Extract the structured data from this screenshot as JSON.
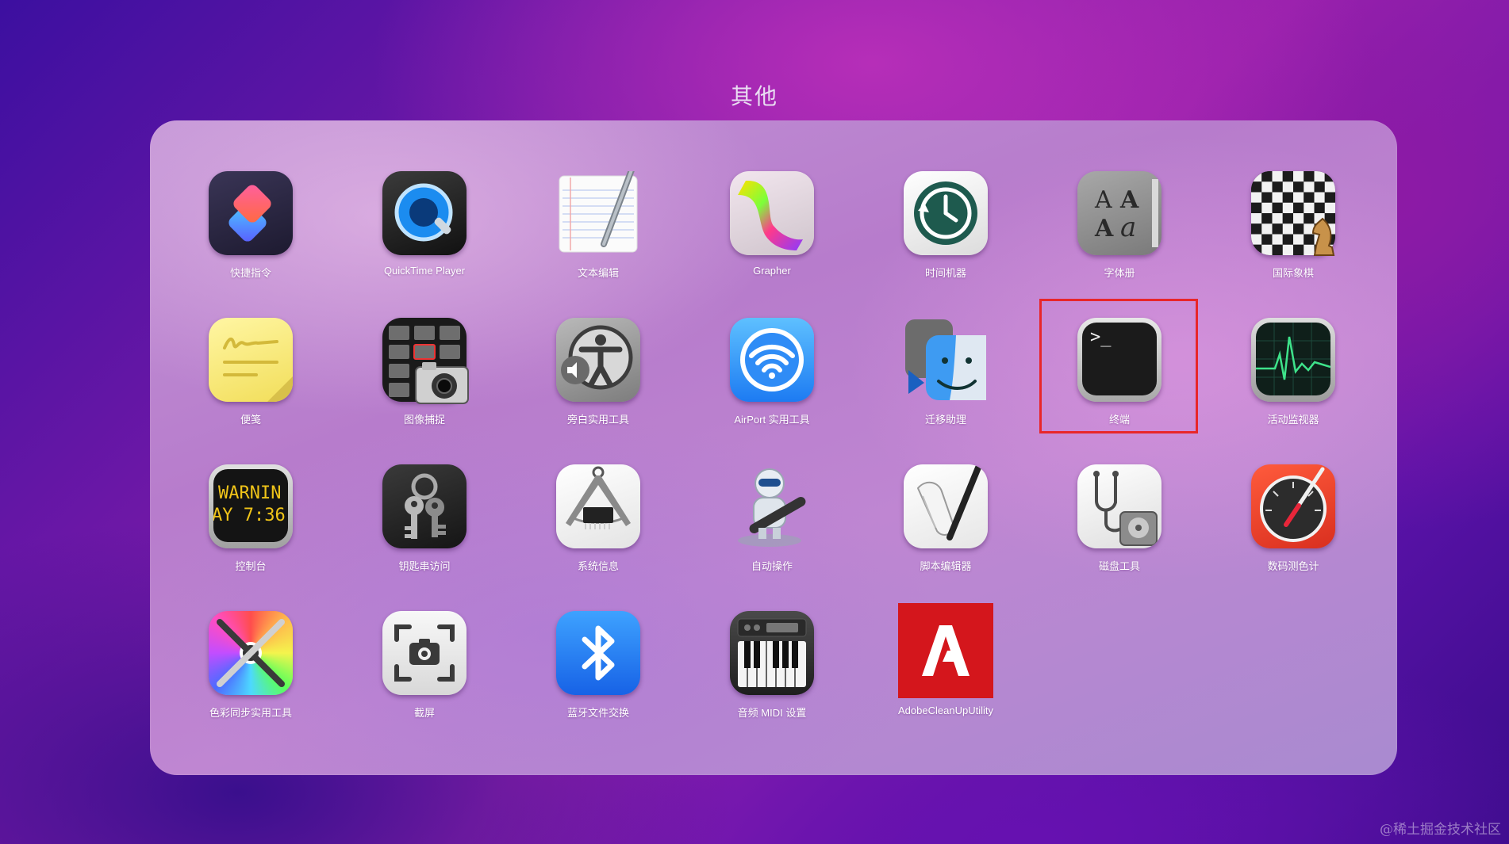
{
  "folder": {
    "title": "其他"
  },
  "apps": [
    {
      "label": "快捷指令",
      "icon": "shortcuts-icon"
    },
    {
      "label": "QuickTime Player",
      "icon": "quicktime-icon"
    },
    {
      "label": "文本编辑",
      "icon": "textedit-icon"
    },
    {
      "label": "Grapher",
      "icon": "grapher-icon"
    },
    {
      "label": "时间机器",
      "icon": "time-machine-icon"
    },
    {
      "label": "字体册",
      "icon": "font-book-icon"
    },
    {
      "label": "国际象棋",
      "icon": "chess-icon"
    },
    {
      "label": "便笺",
      "icon": "stickies-icon"
    },
    {
      "label": "图像捕捉",
      "icon": "image-capture-icon"
    },
    {
      "label": "旁白实用工具",
      "icon": "voiceover-utility-icon"
    },
    {
      "label": "AirPort 实用工具",
      "icon": "airport-utility-icon"
    },
    {
      "label": "迁移助理",
      "icon": "migration-assistant-icon"
    },
    {
      "label": "终端",
      "icon": "terminal-icon"
    },
    {
      "label": "活动监视器",
      "icon": "activity-monitor-icon"
    },
    {
      "label": "控制台",
      "icon": "console-icon"
    },
    {
      "label": "钥匙串访问",
      "icon": "keychain-access-icon"
    },
    {
      "label": "系统信息",
      "icon": "system-information-icon"
    },
    {
      "label": "自动操作",
      "icon": "automator-icon"
    },
    {
      "label": "脚本编辑器",
      "icon": "script-editor-icon"
    },
    {
      "label": "磁盘工具",
      "icon": "disk-utility-icon"
    },
    {
      "label": "数码测色计",
      "icon": "digital-color-meter-icon"
    },
    {
      "label": "色彩同步实用工具",
      "icon": "colorsync-utility-icon"
    },
    {
      "label": "截屏",
      "icon": "screenshot-icon"
    },
    {
      "label": "蓝牙文件交换",
      "icon": "bluetooth-file-exchange-icon"
    },
    {
      "label": "音频 MIDI 设置",
      "icon": "audio-midi-setup-icon"
    },
    {
      "label": "AdobeCleanUpUtility",
      "icon": "adobe-cleanup-icon"
    }
  ],
  "console_icon_text": {
    "line1": "WARNIN",
    "line2": "AY 7:36"
  },
  "terminal_prompt": ">_",
  "highlight": {
    "target": "终端",
    "color": "#e8262a"
  },
  "watermark": "@稀土掘金技术社区"
}
